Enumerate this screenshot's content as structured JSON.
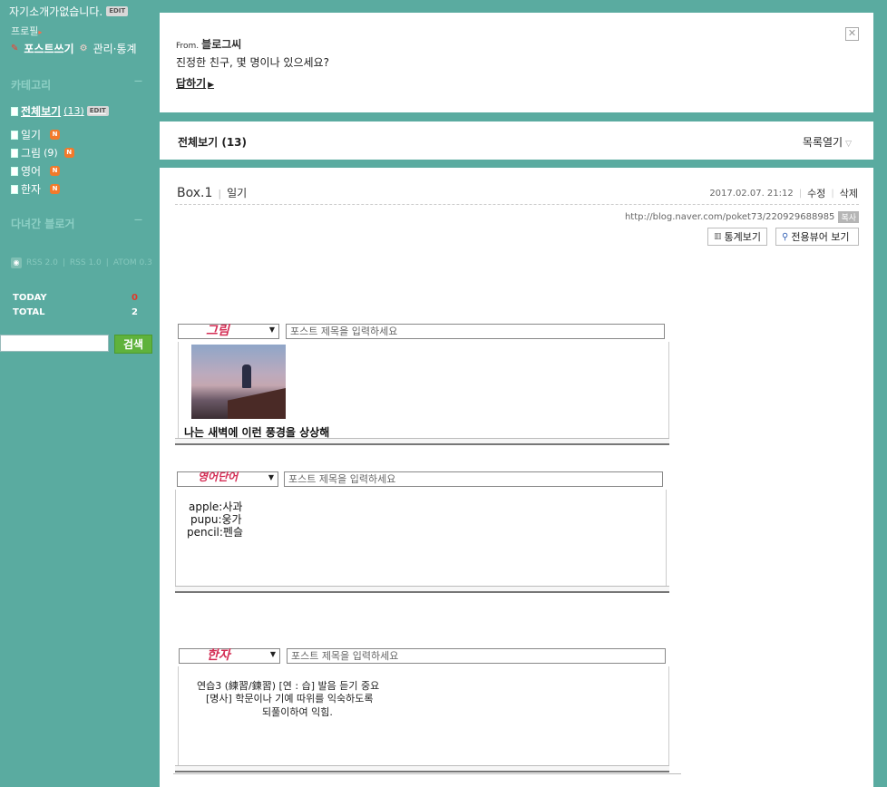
{
  "sidebar": {
    "intro": "자기소개가없습니다.",
    "edit_badge": "EDIT",
    "profile": "프로필",
    "write_post": "포스트쓰기",
    "manage": "관리·통계",
    "category_heading": "카테고리",
    "categories": [
      {
        "label": "전체보기",
        "count": "(13)",
        "badge": "EDIT"
      },
      {
        "label": "일기",
        "count": "",
        "badge": "N"
      },
      {
        "label": "그림",
        "count": "(9)",
        "badge": "N"
      },
      {
        "label": "영어",
        "count": "",
        "badge": "N"
      },
      {
        "label": "한자",
        "count": "",
        "badge": "N"
      }
    ],
    "visited_heading": "다녀간 블로거",
    "rss_links": [
      "RSS 2.0",
      "RSS 1.0",
      "ATOM 0.3"
    ],
    "stats": [
      {
        "label": "TODAY",
        "value": "0"
      },
      {
        "label": "TOTAL",
        "value": "2"
      }
    ],
    "search_button": "검색"
  },
  "guest": {
    "from_label": "From.",
    "from_name": "블로그씨",
    "message": "진정한 친구, 몇 명이나 있으세요?",
    "reply": "답하기"
  },
  "listbar": {
    "title": "전체보기 (13)",
    "open": "목록열기"
  },
  "post": {
    "title": "Box.1",
    "category": "일기",
    "date": "2017.02.07. 21:12",
    "edit": "수정",
    "delete": "삭제",
    "url": "http://blog.naver.com/poket73/220929688985",
    "copy": "복사",
    "stats_button": "통계보기",
    "viewer_button": "전용뷰어 보기",
    "title_placeholder": "포스트 제목을 입력하세요",
    "shots": [
      {
        "category": "그림",
        "caption": "나는 새벽에 이런 풍경을 상상해"
      },
      {
        "category": "영어단어",
        "words": [
          "apple:사과",
          "pupu:웅가",
          "pencil:펜슬"
        ]
      },
      {
        "category": "한자",
        "lines": [
          "연습3 (練習/鍊習) [연 : 습]  발음 듣기 중요",
          "[명사] 학문이나 기예 따위를 익숙하도록",
          "되풀이하여 익힘."
        ]
      }
    ]
  },
  "colors": {
    "background": "#5aaba0",
    "badge_new": "#f27a2b",
    "search_button": "#5fb23c",
    "today_value": "#e03a2a"
  }
}
